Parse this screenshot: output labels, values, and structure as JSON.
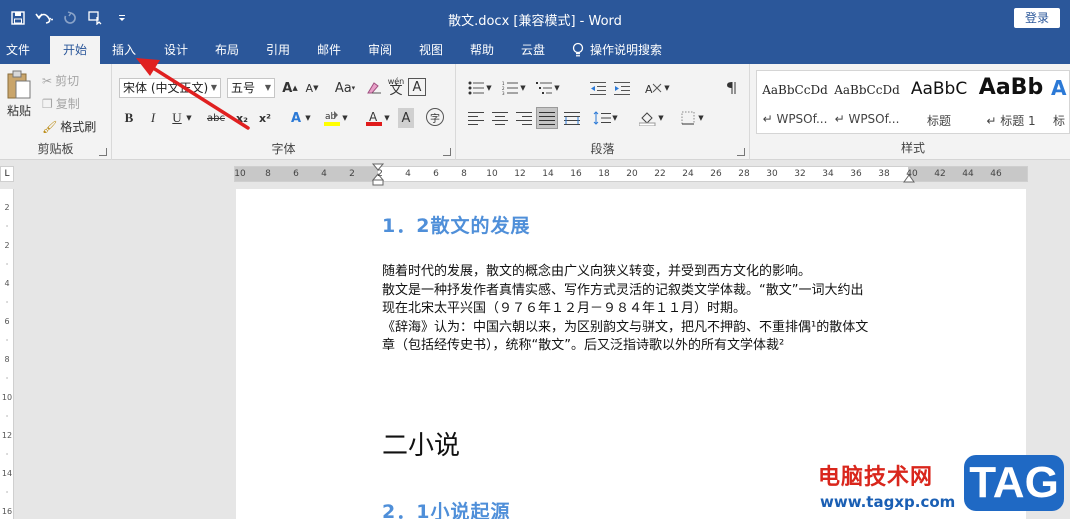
{
  "window": {
    "title": "散文.docx [兼容模式] - Word",
    "login_label": "登录"
  },
  "quick_access": {
    "icons": [
      "save-icon",
      "undo-icon",
      "redo-icon",
      "touch-mode-icon",
      "customize-icon"
    ]
  },
  "tabs": [
    {
      "label": "文件"
    },
    {
      "label": "开始",
      "active": true
    },
    {
      "label": "插入"
    },
    {
      "label": "设计"
    },
    {
      "label": "布局"
    },
    {
      "label": "引用"
    },
    {
      "label": "邮件"
    },
    {
      "label": "审阅"
    },
    {
      "label": "视图"
    },
    {
      "label": "帮助"
    },
    {
      "label": "云盘"
    }
  ],
  "tell_me": "操作说明搜索",
  "ribbon": {
    "clipboard": {
      "label": "剪贴板",
      "paste": "粘贴",
      "cut": "剪切",
      "copy": "复制",
      "format_painter": "格式刷"
    },
    "font": {
      "label": "字体",
      "font_name": "宋体 (中文正文)",
      "font_size": "五号",
      "wen": "wén",
      "wen_char": "文",
      "a_char": "A",
      "aa": "Aa",
      "bold": "B",
      "italic": "I",
      "underline": "U",
      "strike": "abc",
      "sub": "x₂",
      "sup": "x²",
      "circle_char": "字"
    },
    "paragraph": {
      "label": "段落"
    },
    "styles": {
      "label": "样式",
      "items": [
        {
          "preview": "AaBbCcDd",
          "name": "↵ WPSOf..."
        },
        {
          "preview": "AaBbCcDd",
          "name": "↵ WPSOf..."
        },
        {
          "preview": "AaBbC",
          "name": "标题"
        },
        {
          "preview": "AaBb",
          "name": "↵ 标题 1"
        },
        {
          "preview": "A",
          "name": "标"
        }
      ]
    }
  },
  "ruler": {
    "ticks": [
      "10",
      "8",
      "6",
      "4",
      "2",
      "2",
      "4",
      "6",
      "8",
      "10",
      "12",
      "14",
      "16",
      "18",
      "20",
      "22",
      "24",
      "26",
      "28",
      "30",
      "32",
      "34",
      "36",
      "38",
      "40",
      "42",
      "44",
      "46"
    ],
    "vticks": [
      "2",
      "",
      "2",
      "",
      "4",
      "",
      "6",
      "",
      "8",
      "",
      "10",
      "",
      "12",
      "",
      "14",
      "",
      "16"
    ]
  },
  "document": {
    "heading_1_2": "1．2散文的发展",
    "paragraph_lines": [
      "随着时代的发展，散文的概念由广义向狭义转变，并受到西方文化的影响。",
      "散文是一种抒发作者真情实感、写作方式灵活的记叙类文学体裁。“散文”一词大约出",
      "现在北宋太平兴国（９７６年１２月－９８４年１１月）时期。",
      "《辞海》认为：中国六朝以来，为区别韵文与骈文，把凡不押韵、不重排偶¹的散体文",
      "章（包括经传史书），统称“散文”。后又泛指诗歌以外的所有文学体裁²"
    ],
    "heading_chapter2": "二小说",
    "heading_2_1": "2．1小说起源"
  },
  "watermark": {
    "cn": "电脑技术网",
    "url": "www.tagxp.com",
    "tag": "TAG"
  },
  "colors": {
    "brand": "#2b579a",
    "heading_blue": "#4f8fd9",
    "arrow_red": "#e02020"
  }
}
